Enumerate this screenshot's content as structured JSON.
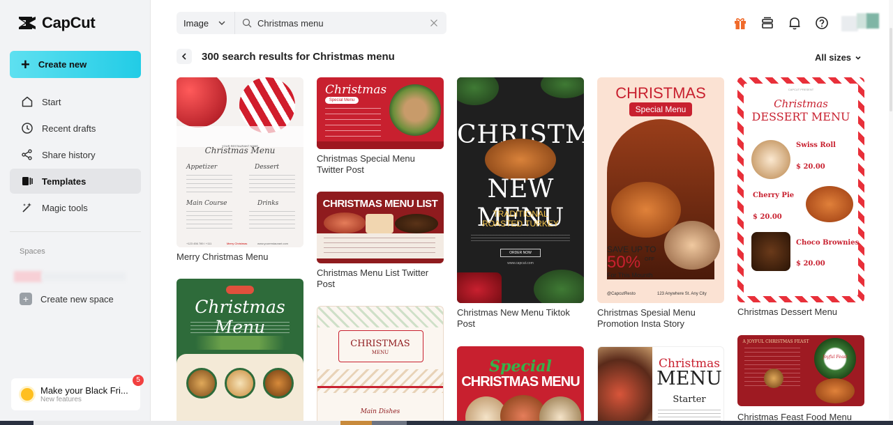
{
  "app": {
    "name": "CapCut"
  },
  "sidebar": {
    "create_label": "Create new",
    "items": [
      {
        "label": "Start",
        "icon": "home-icon"
      },
      {
        "label": "Recent drafts",
        "icon": "clock-icon"
      },
      {
        "label": "Share history",
        "icon": "share-icon"
      },
      {
        "label": "Templates",
        "icon": "templates-icon",
        "active": true
      },
      {
        "label": "Magic tools",
        "icon": "magic-wand-icon"
      }
    ],
    "spaces_label": "Spaces",
    "create_space_label": "Create new space",
    "promo": {
      "title": "Make your Black Fri...",
      "subtitle": "New features",
      "badge": "5"
    }
  },
  "search": {
    "type": "Image",
    "value": "Christmas menu"
  },
  "results": {
    "title": "300 search results for Christmas menu",
    "sizes_label": "All sizes"
  },
  "cards": [
    {
      "caption": "Merry Christmas Menu",
      "lines": [
        "YOUR RESTAURANT NAME",
        "Christmas Menu",
        "Appetizer",
        "Dessert",
        "Main Course",
        "Drinks",
        "+123 456 789 / +111",
        "Merry Christmas",
        "www.yourrestaurant.com"
      ]
    },
    {
      "caption": "Christmas Special Menu Twitter Post",
      "lines": [
        "Christmas",
        "Special Menu"
      ]
    },
    {
      "caption": "Christmas Menu List Twitter Post",
      "lines": [
        "CHRISTMAS MENU LIST"
      ]
    },
    {
      "caption": "",
      "lines": [
        "CHRISTMAS",
        "MENU",
        "Main Dishes"
      ]
    },
    {
      "caption": "Christmas New Menu Tiktok Post",
      "lines": [
        "CHRISTMAS",
        "NEW MENU",
        "TRADITIONAL",
        "ROASTED TURKEY",
        "ORDER NOW",
        "www.capcut.com"
      ]
    },
    {
      "caption": "",
      "lines": [
        "Special",
        "CHRISTMAS MENU"
      ]
    },
    {
      "caption": "Christmas Spesial Menu Promotion Insta Story",
      "lines": [
        "CHRISTMAS",
        "Special Menu",
        "SAVE UP TO",
        "50%",
        "OFF",
        "For This Mounth",
        "@CapcutResto",
        "123 Anywhere St. Any City"
      ]
    },
    {
      "caption": "",
      "lines": [
        "Christmas",
        "MENU",
        "Starter"
      ]
    },
    {
      "caption": "Christmas Dessert Menu",
      "lines": [
        "CAPCUT PRESENT",
        "Christmas",
        "DESSERT MENU",
        "Swiss Roll",
        "$ 20.00",
        "Cherry Pie",
        "$ 20.00",
        "Choco Brownies",
        "$ 20.00"
      ]
    },
    {
      "caption": "Christmas Feast Food Menu",
      "lines": [
        "A JOYFUL CHRISTMAS FEAST",
        "Joyful Feast"
      ]
    }
  ],
  "colors": {
    "accent": "#22cce6",
    "christmas_red": "#c8202f",
    "christmas_green": "#2e6b3a"
  }
}
